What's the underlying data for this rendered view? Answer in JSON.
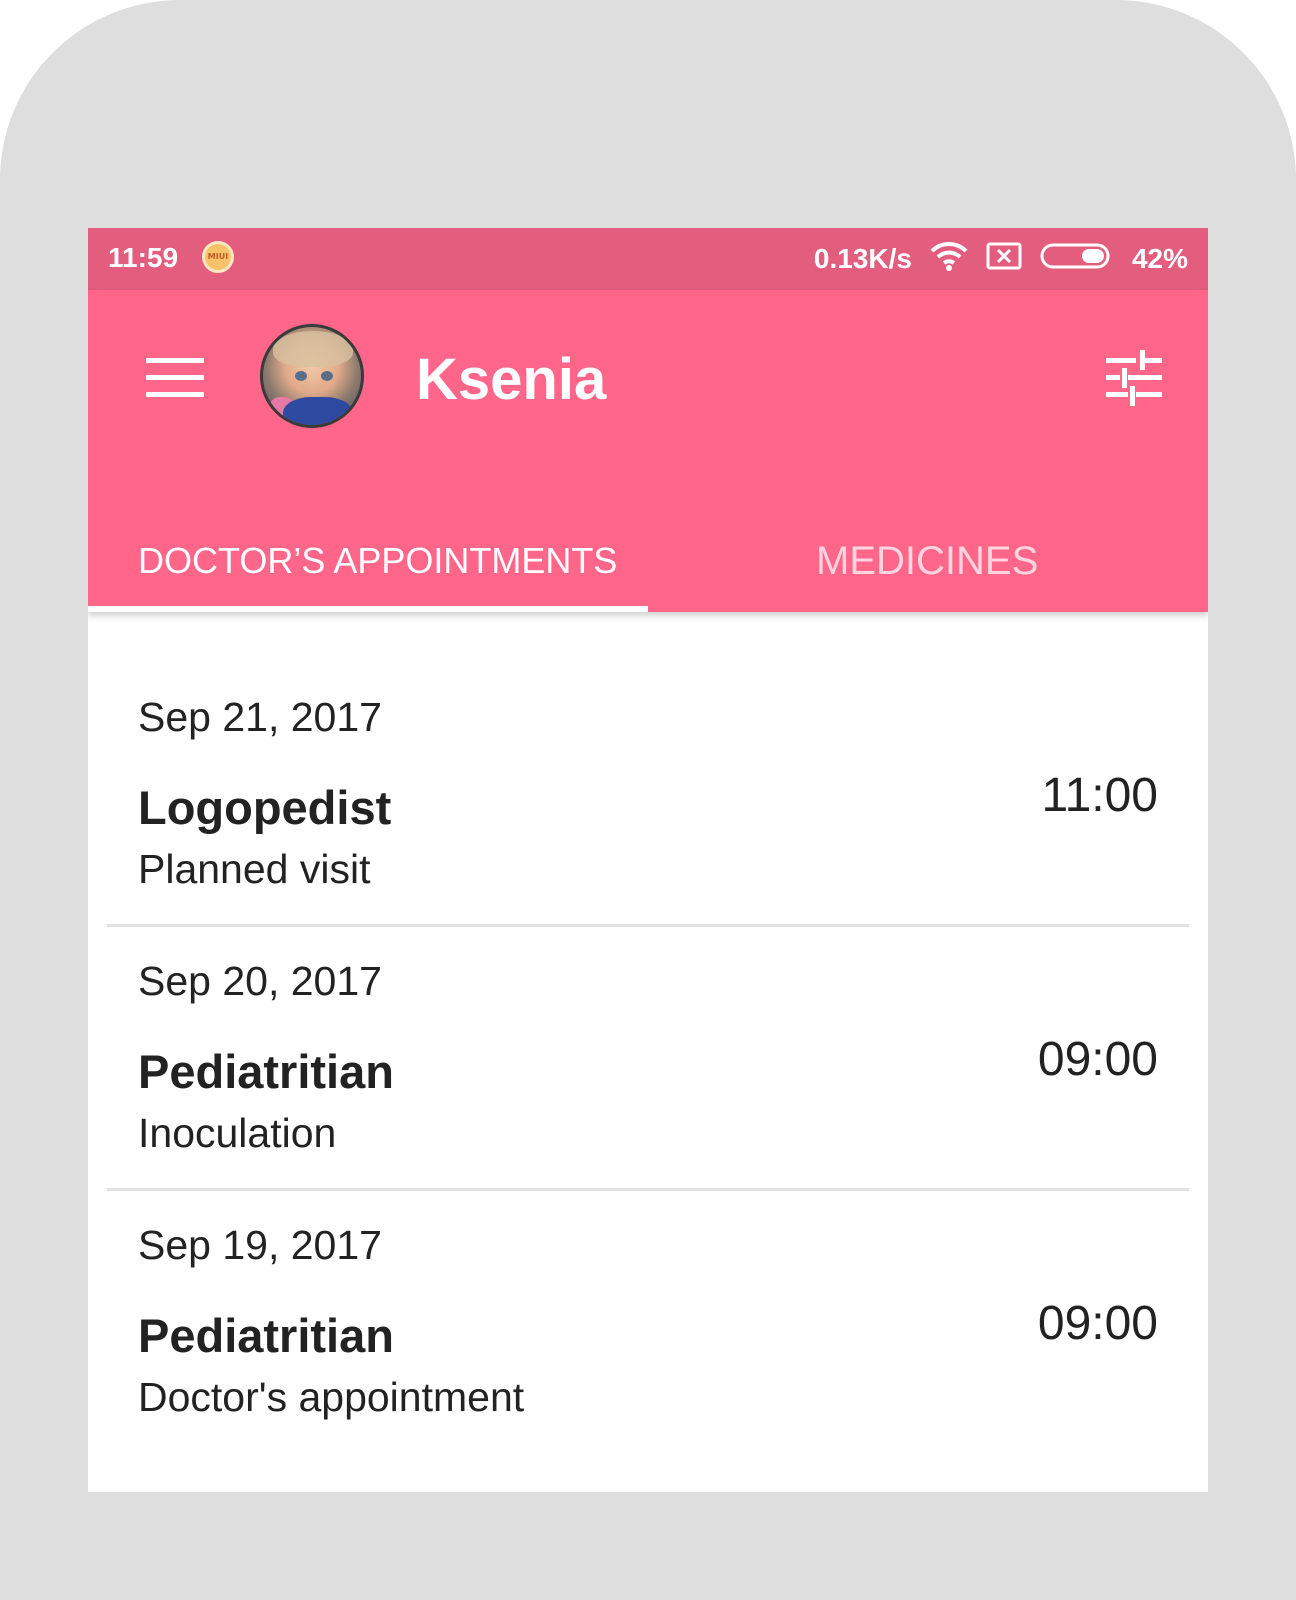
{
  "status_bar": {
    "time": "11:59",
    "miui_badge": "MIUI",
    "network_speed": "0.13K/s",
    "battery": "42%",
    "icons": [
      "wifi-icon",
      "sim-error-icon",
      "battery-icon"
    ]
  },
  "app_bar": {
    "user_name": "Ksenia",
    "icons": [
      "menu-icon",
      "avatar",
      "filter-icon"
    ],
    "color": "#ff668a",
    "status_color": "#e25d7e"
  },
  "tabs": [
    {
      "label": "DOCTOR’S APPOINTMENTS",
      "selected": true
    },
    {
      "label": "MEDICINES",
      "selected": false
    }
  ],
  "appointments": [
    {
      "date": "Sep 21, 2017",
      "title": "Logopedist",
      "subtitle": "Planned visit",
      "time": "11:00"
    },
    {
      "date": "Sep 20, 2017",
      "title": "Pediatritian",
      "subtitle": "Inoculation",
      "time": "09:00"
    },
    {
      "date": "Sep 19, 2017",
      "title": "Pediatritian",
      "subtitle": "Doctor's appointment",
      "time": "09:00"
    }
  ]
}
